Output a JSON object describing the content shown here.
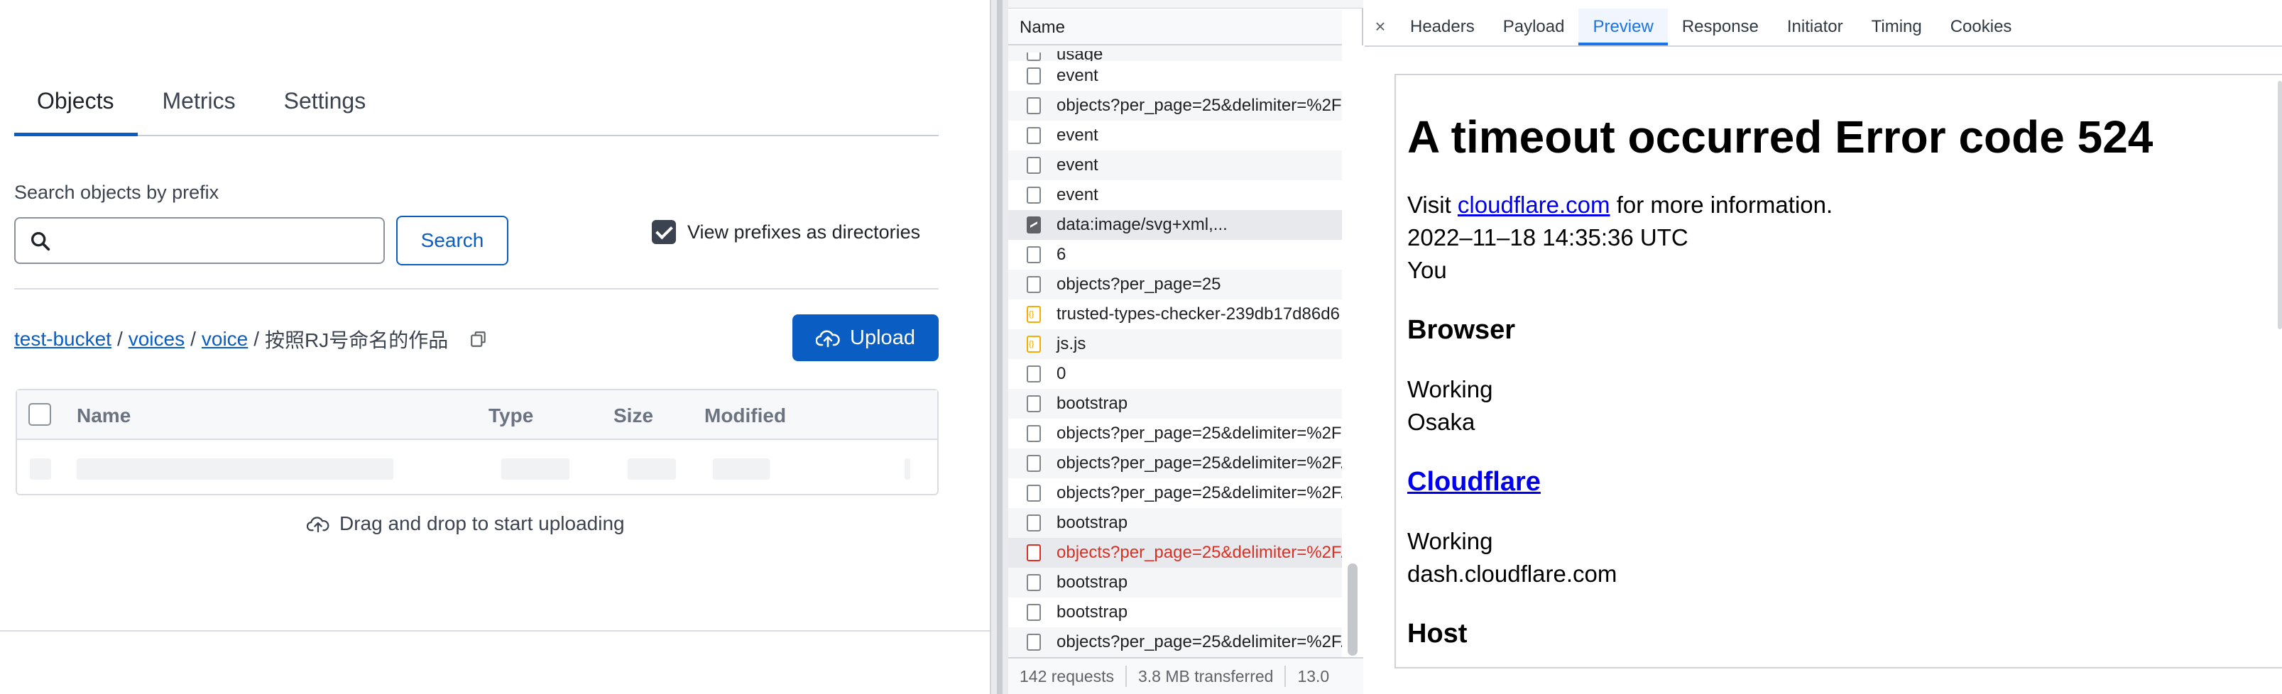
{
  "left": {
    "tabs": [
      {
        "label": "Objects",
        "active": true
      },
      {
        "label": "Metrics",
        "active": false
      },
      {
        "label": "Settings",
        "active": false
      }
    ],
    "search": {
      "label": "Search objects by prefix",
      "value": "",
      "placeholder": "",
      "button": "Search"
    },
    "view_prefixes_label": "View prefixes as directories",
    "breadcrumb": {
      "links": [
        "test-bucket",
        "voices",
        "voice"
      ],
      "current": "按照RJ号命名的作品",
      "separator": "/"
    },
    "upload_label": "Upload",
    "table": {
      "headers": {
        "name": "Name",
        "type": "Type",
        "size": "Size",
        "modified": "Modified"
      }
    },
    "drag_drop_text": "Drag and drop to start uploading"
  },
  "network": {
    "name_header": "Name",
    "rows": [
      {
        "name": "usage",
        "icon": "doc",
        "style": "partial"
      },
      {
        "name": "event",
        "icon": "doc"
      },
      {
        "name": "objects?per_page=25&delimiter=%2F",
        "icon": "doc"
      },
      {
        "name": "event",
        "icon": "doc"
      },
      {
        "name": "event",
        "icon": "doc"
      },
      {
        "name": "event",
        "icon": "doc"
      },
      {
        "name": "data:image/svg+xml,...",
        "icon": "img"
      },
      {
        "name": "6",
        "icon": "doc"
      },
      {
        "name": "objects?per_page=25",
        "icon": "doc"
      },
      {
        "name": "trusted-types-checker-239db17d86d6",
        "icon": "js"
      },
      {
        "name": "js.js",
        "icon": "js"
      },
      {
        "name": "0",
        "icon": "doc"
      },
      {
        "name": "bootstrap",
        "icon": "doc"
      },
      {
        "name": "objects?per_page=25&delimiter=%2F",
        "icon": "doc"
      },
      {
        "name": "objects?per_page=25&delimiter=%2F...",
        "icon": "doc"
      },
      {
        "name": "objects?per_page=25&delimiter=%2F...",
        "icon": "doc"
      },
      {
        "name": "bootstrap",
        "icon": "doc"
      },
      {
        "name": "objects?per_page=25&delimiter=%2F...",
        "icon": "doc",
        "status": "error"
      },
      {
        "name": "bootstrap",
        "icon": "doc"
      },
      {
        "name": "bootstrap",
        "icon": "doc"
      },
      {
        "name": "objects?per_page=25&delimiter=%2F...",
        "icon": "doc"
      }
    ],
    "status": {
      "requests": "142 requests",
      "transferred": "3.8 MB transferred",
      "resources": "13.0"
    }
  },
  "detail": {
    "close": "×",
    "tabs": [
      "Headers",
      "Payload",
      "Preview",
      "Response",
      "Initiator",
      "Timing",
      "Cookies"
    ],
    "active_tab": "Preview",
    "preview": {
      "title": "A timeout occurred Error code 524",
      "visit_prefix": "Visit ",
      "visit_link": "cloudflare.com",
      "visit_suffix": " for more information.",
      "timestamp": "2022–11–18 14:35:36 UTC",
      "you": "You",
      "browser_heading": "Browser",
      "browser_status": "Working",
      "browser_location": "Osaka",
      "cloudflare_heading": "Cloudflare",
      "cloudflare_status": "Working",
      "cloudflare_host": "dash.cloudflare.com",
      "host_heading": "Host"
    }
  },
  "colors": {
    "accent": "#0a5dc2",
    "devtools_accent": "#1a73e8",
    "error": "#d93025",
    "link": "#0000ee"
  }
}
